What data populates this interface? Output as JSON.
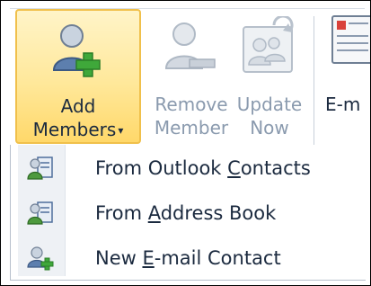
{
  "ribbon": {
    "add_members": {
      "line1": "Add",
      "line2": "Members",
      "arrow": "▾",
      "icon": "add-members-icon"
    },
    "remove_member": {
      "line1": "Remove",
      "line2": "Member",
      "icon": "remove-member-icon"
    },
    "update_now": {
      "line1": "Update",
      "line2": "Now",
      "icon": "update-now-icon"
    },
    "email": {
      "line1": "E-m",
      "icon": "email-icon"
    }
  },
  "menu": {
    "items": [
      {
        "label_pre": "From Outlook ",
        "label_acc": "C",
        "label_post": "ontacts",
        "icon": "outlook-contacts-icon"
      },
      {
        "label_pre": "From ",
        "label_acc": "A",
        "label_post": "ddress Book",
        "icon": "address-book-icon"
      },
      {
        "label_pre": "New ",
        "label_acc": "E",
        "label_post": "-mail Contact",
        "icon": "new-email-contact-icon"
      }
    ]
  },
  "colors": {
    "highlight_fill": "#ffe89a",
    "highlight_border": "#f0c04b",
    "text": "#1b2a3f",
    "disabled_text": "#8a9aae"
  }
}
